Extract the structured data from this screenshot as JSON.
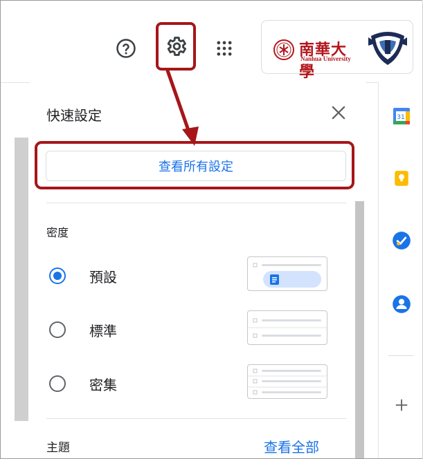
{
  "topbar": {
    "help_icon": "help-circle-icon",
    "settings_icon": "gear-icon",
    "apps_icon": "apps-grid-icon",
    "account": {
      "org_name": "南華大學",
      "org_name_en": "Nanhua University"
    }
  },
  "quick_settings": {
    "title": "快速設定",
    "close_icon": "close-icon",
    "see_all_settings": "查看所有設定",
    "density": {
      "label": "密度",
      "options": [
        {
          "label": "預設",
          "selected": true
        },
        {
          "label": "標準",
          "selected": false
        },
        {
          "label": "密集",
          "selected": false
        }
      ]
    },
    "theme": {
      "label": "主題",
      "view_all": "查看全部"
    }
  },
  "side_apps": [
    {
      "name": "calendar",
      "badge": "31"
    },
    {
      "name": "keep"
    },
    {
      "name": "tasks"
    },
    {
      "name": "contacts"
    },
    {
      "name": "add"
    }
  ],
  "colors": {
    "accent": "#1a73e8",
    "highlight": "#a61619"
  }
}
